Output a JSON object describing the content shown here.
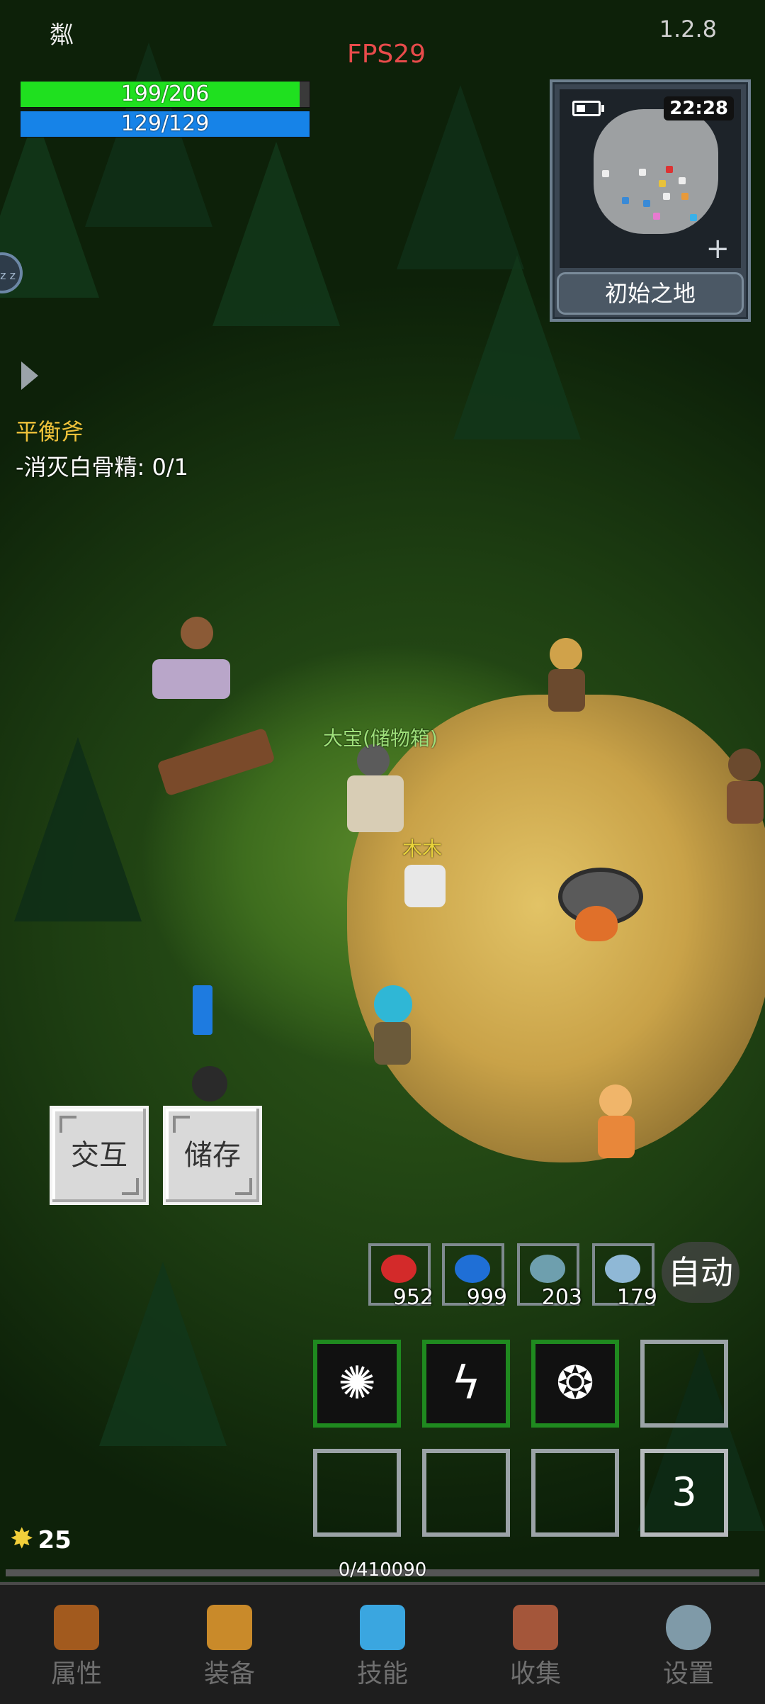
{
  "app": {
    "version": "1.2.8",
    "fps": "FPS29",
    "player_name_glyph": "粼"
  },
  "status": {
    "hp": {
      "text": "199/206",
      "current": 199,
      "max": 206,
      "color": "#1fe01f"
    },
    "mp": {
      "text": "129/129",
      "current": 129,
      "max": 129,
      "color": "#1683e8"
    }
  },
  "minimap": {
    "time": "22:28",
    "location": "初始之地",
    "zoom_icon": "plus-icon",
    "battery_icon": "battery-icon"
  },
  "quest": {
    "title": "平衡斧",
    "objective": "-消灭白骨精: 0/1"
  },
  "world": {
    "npc_storage_label": "大宝(储物箱)",
    "pet_label": "木木"
  },
  "actions": {
    "interact": "交互",
    "store": "储存"
  },
  "potions": [
    {
      "name": "red-potion-icon",
      "count": "952",
      "color": "#d32a2a"
    },
    {
      "name": "blue-potion-icon",
      "count": "999",
      "color": "#1f6fd6"
    },
    {
      "name": "fish-icon",
      "count": "203",
      "color": "#6e9fae"
    },
    {
      "name": "scroll-icon",
      "count": "179",
      "color": "#8fb8d6"
    }
  ],
  "auto_label": "自动",
  "skills": [
    {
      "name": "skill-burst-icon",
      "glyph": "✺"
    },
    {
      "name": "skill-lightning-icon",
      "glyph": "ϟ"
    },
    {
      "name": "skill-gear-icon",
      "glyph": "❂"
    }
  ],
  "skill_page": "3",
  "gold": "25",
  "exp": {
    "text": "0/410090",
    "current": 0,
    "max": 410090
  },
  "nav": [
    {
      "label": "属性",
      "icon": "helmet-icon",
      "color": "#a25a1e"
    },
    {
      "label": "装备",
      "icon": "bag-icon",
      "color": "#c98a2a"
    },
    {
      "label": "技能",
      "icon": "crystal-icon",
      "color": "#3aa6e0"
    },
    {
      "label": "收集",
      "icon": "book-icon",
      "color": "#a4563a"
    },
    {
      "label": "设置",
      "icon": "gear-icon",
      "color": "#7f9aa8"
    }
  ]
}
